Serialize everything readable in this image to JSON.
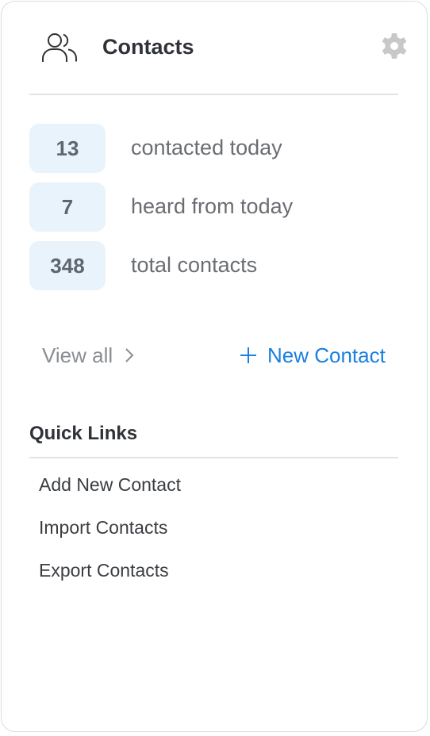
{
  "header": {
    "title": "Contacts",
    "icon": "contacts-icon",
    "settings_icon": "gear-icon"
  },
  "stats": [
    {
      "value": "13",
      "label": "contacted today"
    },
    {
      "value": "7",
      "label": "heard from today"
    },
    {
      "value": "348",
      "label": "total contacts"
    }
  ],
  "actions": {
    "view_all": "View all",
    "new_contact": "New Contact"
  },
  "quick_links": {
    "title": "Quick Links",
    "items": [
      "Add New Contact",
      "Import Contacts",
      "Export Contacts"
    ]
  },
  "colors": {
    "accent": "#1a7fe0",
    "pill_bg": "#e8f3fc"
  }
}
